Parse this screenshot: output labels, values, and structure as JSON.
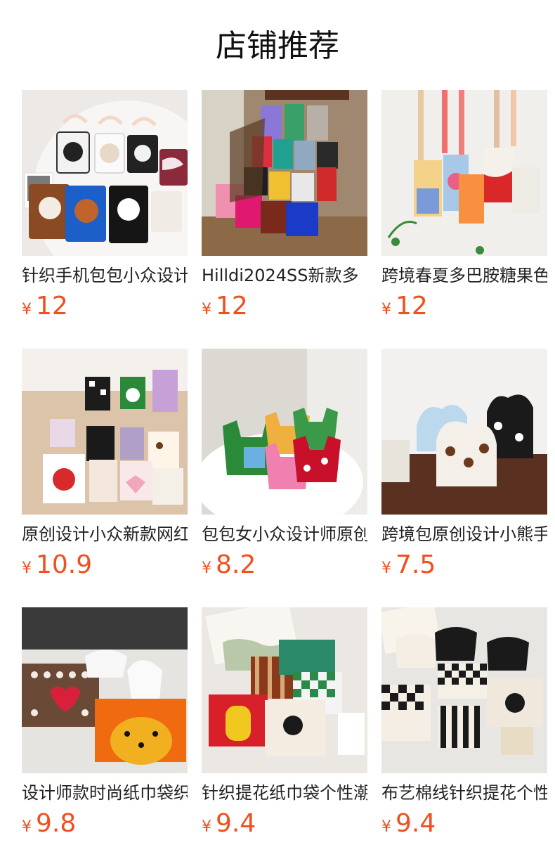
{
  "section": {
    "title": "店铺推荐"
  },
  "colors": {
    "price": "#f24e1e",
    "title": "#111111",
    "text": "#222222",
    "background": "#ffffff"
  },
  "currency": "¥",
  "products": [
    {
      "name": "针织手机包包小众设计",
      "price": "12",
      "image": "knit-phone-bags-photo"
    },
    {
      "name": "Hilldi2024SS新款多",
      "price": "12",
      "image": "knit-bags-on-chair-photo"
    },
    {
      "name": "跨境春夏多巴胺糖果色",
      "price": "12",
      "image": "hanging-colorful-bags-photo"
    },
    {
      "name": "原创设计小众新款网红",
      "price": "10.9",
      "image": "knot-wrist-bags-photo"
    },
    {
      "name": "包包女小众设计师原创",
      "price": "8.2",
      "image": "knit-vest-bags-photo"
    },
    {
      "name": "跨境包原创设计小熊手",
      "price": "7.5",
      "image": "bear-knot-bags-photo"
    },
    {
      "name": "设计师款时尚纸巾袋织",
      "price": "9.8",
      "image": "tissue-bags-photo"
    },
    {
      "name": "针织提花纸巾袋个性潮",
      "price": "9.4",
      "image": "jacquard-tissue-pouch-photo"
    },
    {
      "name": "布艺棉线针织提花个性",
      "price": "9.4",
      "image": "checker-tissue-pouch-photo"
    }
  ]
}
